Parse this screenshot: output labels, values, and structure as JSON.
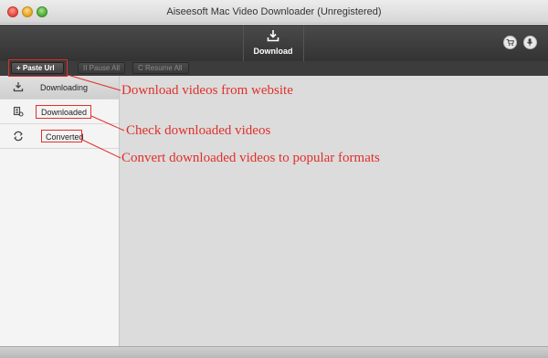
{
  "window": {
    "title": "Aiseesoft Mac Video Downloader (Unregistered)",
    "controls": [
      "close",
      "minimize",
      "maximize"
    ]
  },
  "toolbar": {
    "download_label": "Download",
    "download_icon": "download-tray-icon",
    "right_buttons": [
      "cart-icon",
      "mic-icon"
    ]
  },
  "actions": {
    "paste_url": "+ Paste Url",
    "pause_all": "II Pause All",
    "resume_all": "C Resume All"
  },
  "sidebar": {
    "items": [
      {
        "label": "Downloading",
        "icon": "download-arrow-icon",
        "active": true
      },
      {
        "label": "Downloaded",
        "icon": "film-list-icon",
        "active": false
      },
      {
        "label": "Converted",
        "icon": "convert-cycle-icon",
        "active": false
      }
    ]
  },
  "annotations": {
    "a1": "Download videos from website",
    "a2": "Check downloaded videos",
    "a3": "Convert downloaded videos to popular formats"
  },
  "colors": {
    "annotation": "#e0302a",
    "toolbar": "#3a3a3a",
    "content_bg": "#dcdcdc"
  }
}
